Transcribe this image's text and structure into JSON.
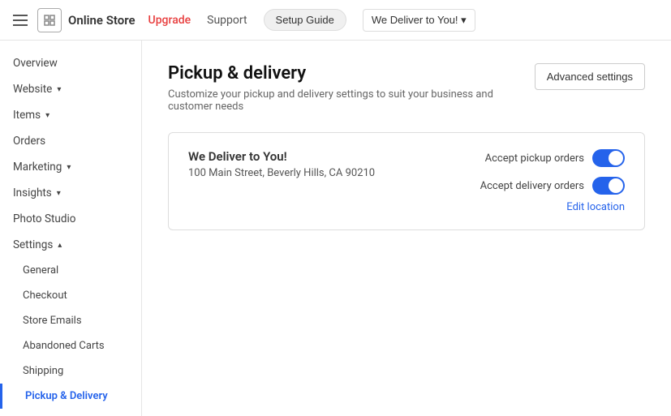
{
  "topNav": {
    "logoText": "Online Store",
    "links": [
      {
        "label": "Upgrade",
        "class": "upgrade"
      },
      {
        "label": "Support"
      },
      {
        "label": "Setup Guide"
      }
    ],
    "storeButton": "We Deliver to You! ▾"
  },
  "sidebar": {
    "items": [
      {
        "id": "overview",
        "label": "Overview",
        "level": "top",
        "active": false
      },
      {
        "id": "website",
        "label": "Website",
        "level": "top",
        "hasChevron": true,
        "active": false
      },
      {
        "id": "items",
        "label": "Items",
        "level": "top",
        "hasChevron": true,
        "active": false
      },
      {
        "id": "orders",
        "label": "Orders",
        "level": "top",
        "active": false
      },
      {
        "id": "marketing",
        "label": "Marketing",
        "level": "top",
        "hasChevron": true,
        "active": false
      },
      {
        "id": "insights",
        "label": "Insights",
        "level": "top",
        "hasChevron": true,
        "active": false
      },
      {
        "id": "photo-studio",
        "label": "Photo Studio",
        "level": "top",
        "active": false
      },
      {
        "id": "settings",
        "label": "Settings",
        "level": "top",
        "hasChevron": true,
        "chevronUp": true,
        "active": false
      },
      {
        "id": "general",
        "label": "General",
        "level": "sub",
        "active": false
      },
      {
        "id": "checkout",
        "label": "Checkout",
        "level": "sub",
        "active": false
      },
      {
        "id": "store-emails",
        "label": "Store Emails",
        "level": "sub",
        "active": false
      },
      {
        "id": "abandoned-carts",
        "label": "Abandoned Carts",
        "level": "sub",
        "active": false
      },
      {
        "id": "shipping",
        "label": "Shipping",
        "level": "sub",
        "active": false
      },
      {
        "id": "pickup-delivery",
        "label": "Pickup & Delivery",
        "level": "sub",
        "active": true
      }
    ]
  },
  "main": {
    "pageTitle": "Pickup & delivery",
    "pageSubtitle": "Customize your pickup and delivery settings to suit your business and customer needs",
    "advancedButtonLabel": "Advanced settings",
    "location": {
      "name": "We Deliver to You!",
      "address": "100 Main Street, Beverly Hills, CA 90210",
      "acceptPickupLabel": "Accept pickup orders",
      "acceptDeliveryLabel": "Accept delivery orders",
      "pickupEnabled": true,
      "deliveryEnabled": true,
      "editLocationLabel": "Edit location"
    }
  }
}
